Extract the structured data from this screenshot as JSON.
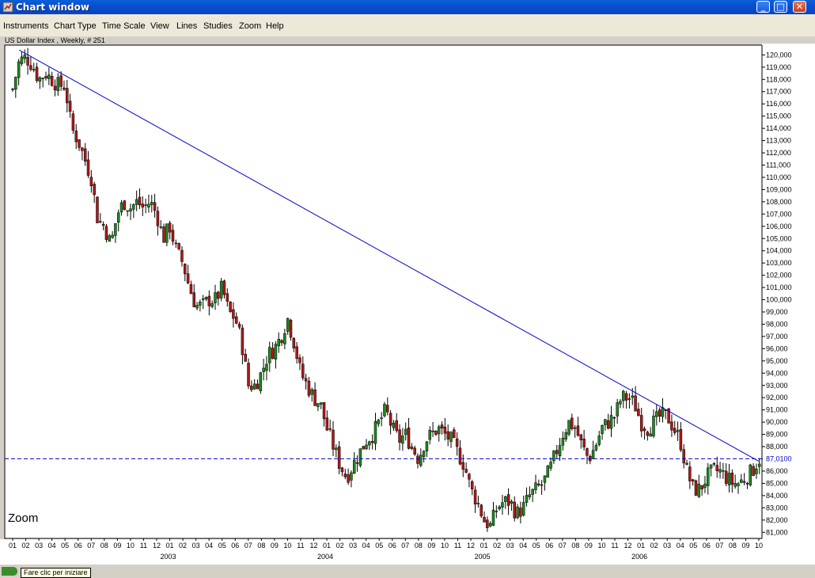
{
  "window": {
    "title": "Chart window",
    "controls": {
      "minimize": "_",
      "maximize": "□",
      "close": "✕"
    }
  },
  "menu": {
    "items": [
      "Instruments",
      "Chart Type",
      "Time Scale",
      "View",
      "Lines",
      "Studies",
      "Zoom",
      "Help"
    ]
  },
  "chart": {
    "label": "US Dollar Index , Weekly, # 251",
    "zoom_label": "Zoom",
    "current_price_label": "87,0100"
  },
  "taskbar": {
    "tooltip": "Fare clic per iniziare"
  },
  "colors": {
    "up_candle": "#1d8a1d",
    "down_candle": "#b01818",
    "trendline": "#0000cc",
    "price_line": "#0000cc",
    "background": "#ffffff"
  },
  "chart_data": {
    "type": "candlestick",
    "title": "US Dollar Index , Weekly, # 251",
    "y_range": [
      80.5,
      120.8
    ],
    "y_ticks": [
      "120,000",
      "119,000",
      "118,000",
      "117,000",
      "116,000",
      "115,000",
      "114,000",
      "113,000",
      "112,000",
      "111,000",
      "110,000",
      "109,000",
      "108,000",
      "107,000",
      "106,000",
      "105,000",
      "104,000",
      "103,000",
      "102,000",
      "101,000",
      "100,000",
      "99,000",
      "98,000",
      "97,000",
      "96,000",
      "95,000",
      "94,000",
      "93,000",
      "92,000",
      "91,000",
      "90,000",
      "89,000",
      "88,000",
      "87,000",
      "86,000",
      "85,000",
      "84,000",
      "83,000",
      "82,000",
      "81,000"
    ],
    "x_month_labels": [
      "01",
      "02",
      "03",
      "04",
      "05",
      "06",
      "07",
      "08",
      "09",
      "10",
      "11",
      "12",
      "01",
      "02",
      "03",
      "04",
      "05",
      "06",
      "07",
      "08",
      "09",
      "10",
      "11",
      "12",
      "01",
      "02",
      "03",
      "04",
      "05",
      "06",
      "07",
      "08",
      "09",
      "10",
      "11",
      "12",
      "01",
      "02",
      "03",
      "04",
      "05",
      "06",
      "07",
      "08",
      "09",
      "10",
      "11",
      "12",
      "01",
      "02",
      "03",
      "04",
      "05",
      "06",
      "07",
      "08",
      "09",
      "10"
    ],
    "x_year_labels": [
      {
        "label": "2003",
        "index": 12
      },
      {
        "label": "2004",
        "index": 24
      },
      {
        "label": "2005",
        "index": 36
      },
      {
        "label": "2006",
        "index": 48
      }
    ],
    "close_path": [
      [
        0,
        117.2
      ],
      [
        0.5,
        119.5
      ],
      [
        1,
        119.8
      ],
      [
        1.5,
        119.2
      ],
      [
        2,
        118.0
      ],
      [
        2.5,
        118.5
      ],
      [
        3,
        118.0
      ],
      [
        3.5,
        117.5
      ],
      [
        4,
        117.5
      ],
      [
        4.5,
        114.0
      ],
      [
        5,
        113.0
      ],
      [
        5.5,
        111.5
      ],
      [
        6,
        110.0
      ],
      [
        6.5,
        106.5
      ],
      [
        7,
        106.0
      ],
      [
        7.5,
        104.5
      ],
      [
        8,
        107.0
      ],
      [
        8.5,
        108.0
      ],
      [
        9,
        107.5
      ],
      [
        9.5,
        108.0
      ],
      [
        10,
        107.5
      ],
      [
        10.5,
        108.0
      ],
      [
        11,
        107.0
      ],
      [
        11.5,
        105.0
      ],
      [
        12,
        106.0
      ],
      [
        12.5,
        104.0
      ],
      [
        13,
        103.0
      ],
      [
        13.5,
        101.0
      ],
      [
        14,
        99.5
      ],
      [
        14.5,
        99.5
      ],
      [
        15,
        100.0
      ],
      [
        15.5,
        100.0
      ],
      [
        16,
        101.0
      ],
      [
        16.5,
        99.0
      ],
      [
        17,
        98.5
      ],
      [
        17.5,
        96.5
      ],
      [
        18,
        93.0
      ],
      [
        18.5,
        93.0
      ],
      [
        19,
        94.0
      ],
      [
        19.5,
        95.5
      ],
      [
        20,
        96.0
      ],
      [
        20.5,
        97.0
      ],
      [
        21,
        98.5
      ],
      [
        21.5,
        96.5
      ],
      [
        22,
        94.0
      ],
      [
        22.5,
        93.0
      ],
      [
        23,
        92.0
      ],
      [
        23.5,
        91.5
      ],
      [
        24,
        89.5
      ],
      [
        24.5,
        88.0
      ],
      [
        25,
        86.5
      ],
      [
        25.5,
        85.5
      ],
      [
        26,
        86.5
      ],
      [
        26.5,
        87.5
      ],
      [
        27,
        88.5
      ],
      [
        27.5,
        89.0
      ],
      [
        28,
        90.0
      ],
      [
        28.5,
        91.0
      ],
      [
        29,
        89.5
      ],
      [
        29.5,
        88.5
      ],
      [
        30,
        89.0
      ],
      [
        30.5,
        88.0
      ],
      [
        31,
        87.0
      ],
      [
        31.5,
        88.5
      ],
      [
        32,
        89.0
      ],
      [
        32.5,
        89.5
      ],
      [
        33,
        89.0
      ],
      [
        33.5,
        88.5
      ],
      [
        34,
        87.5
      ],
      [
        34.5,
        86.5
      ],
      [
        35,
        84.5
      ],
      [
        35.5,
        83.5
      ],
      [
        36,
        82.0
      ],
      [
        36.5,
        81.5
      ],
      [
        37,
        83.0
      ],
      [
        37.5,
        83.5
      ],
      [
        38,
        83.5
      ],
      [
        38.5,
        82.5
      ],
      [
        39,
        83.0
      ],
      [
        39.5,
        84.0
      ],
      [
        40,
        84.5
      ],
      [
        40.5,
        85.0
      ],
      [
        41,
        86.0
      ],
      [
        41.5,
        87.5
      ],
      [
        42,
        89.0
      ],
      [
        42.5,
        90.0
      ],
      [
        43,
        89.5
      ],
      [
        43.5,
        88.0
      ],
      [
        44,
        87.0
      ],
      [
        44.5,
        88.0
      ],
      [
        45,
        89.5
      ],
      [
        45.5,
        90.0
      ],
      [
        46,
        90.5
      ],
      [
        46.5,
        92.0
      ],
      [
        47,
        92.0
      ],
      [
        47.5,
        91.5
      ],
      [
        48,
        90.0
      ],
      [
        48.5,
        89.5
      ],
      [
        49,
        90.0
      ],
      [
        49.5,
        90.5
      ],
      [
        50,
        90.5
      ],
      [
        50.5,
        89.5
      ],
      [
        51,
        88.5
      ],
      [
        51.5,
        86.0
      ],
      [
        52,
        84.5
      ],
      [
        52.5,
        84.5
      ],
      [
        53,
        85.5
      ],
      [
        53.5,
        86.0
      ],
      [
        54,
        86.0
      ],
      [
        54.5,
        85.5
      ],
      [
        55,
        85.0
      ],
      [
        55.5,
        85.0
      ],
      [
        56,
        85.5
      ],
      [
        56.5,
        86.0
      ],
      [
        57,
        87.0
      ]
    ],
    "trendline": [
      [
        0.5,
        120.4
      ],
      [
        57,
        86.8
      ]
    ],
    "price_line": 87.01
  }
}
